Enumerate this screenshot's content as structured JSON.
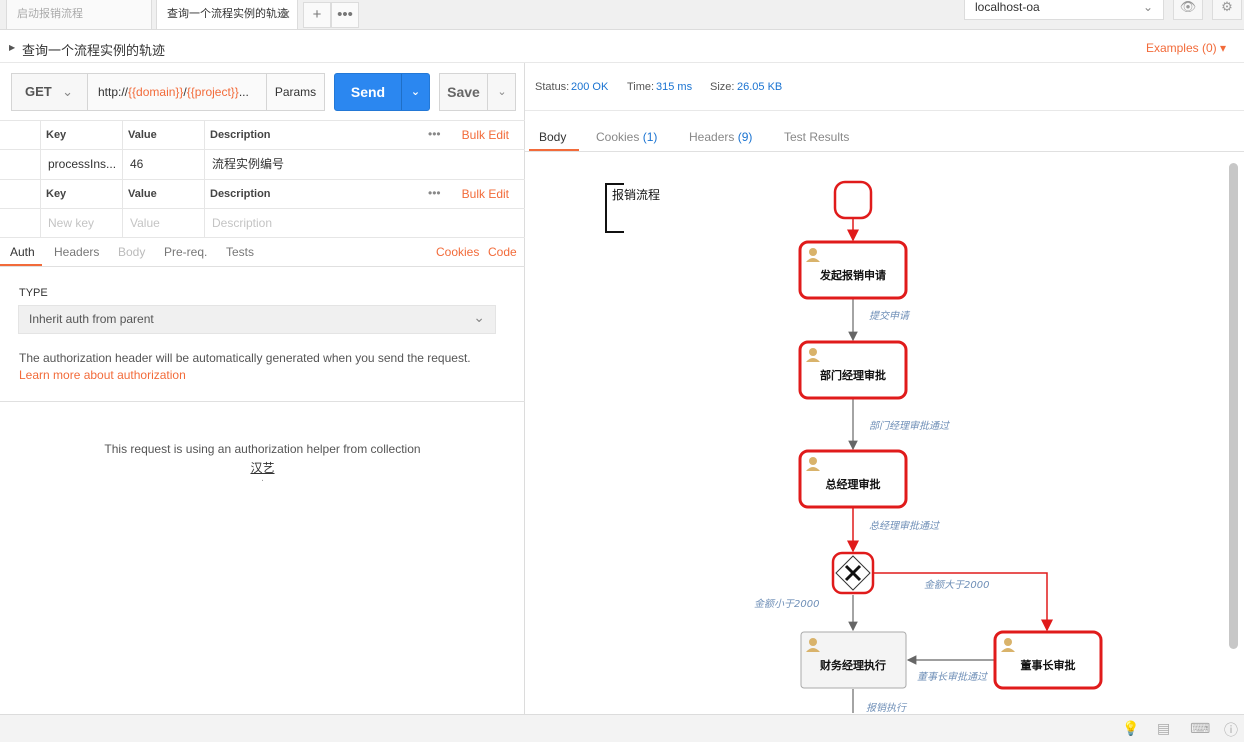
{
  "tabs": [
    {
      "label": "启动报销流程"
    },
    {
      "label": "查询一个流程实例的轨迹"
    }
  ],
  "environment": "localhost-oa",
  "request": {
    "title": "查询一个流程实例的轨迹",
    "examples": "Examples (0)",
    "method": "GET",
    "url_prefix": "http://",
    "url_var1": "{{domain}}",
    "url_sep": "/",
    "url_var2": "{{project}}",
    "url_ellipsis": "...",
    "params_label": "Params",
    "send_label": "Send",
    "save_label": "Save"
  },
  "params_table": {
    "headers": {
      "key": "Key",
      "value": "Value",
      "description": "Description"
    },
    "bulk_edit": "Bulk Edit",
    "rows": [
      {
        "key": "processIns...",
        "value": "46",
        "description": "流程实例编号"
      }
    ]
  },
  "headers_table": {
    "headers": {
      "key": "Key",
      "value": "Value",
      "description": "Description"
    },
    "bulk_edit": "Bulk Edit",
    "placeholders": {
      "key": "New key",
      "value": "Value",
      "description": "Description"
    }
  },
  "req_tabs": {
    "auth": "Auth",
    "headers": "Headers",
    "body": "Body",
    "prereq": "Pre-req.",
    "tests": "Tests",
    "cookies": "Cookies",
    "code": "Code"
  },
  "auth": {
    "type_label": "TYPE",
    "type_value": "Inherit auth from parent",
    "info": "The authorization header will be automatically generated when you send the request.",
    "learn_more": "Learn more about authorization",
    "helper_text": "This request is using an authorization helper from collection",
    "collection": "汉艺",
    "dot": "."
  },
  "response": {
    "status_label": "Status:",
    "status_value": "200 OK",
    "time_label": "Time:",
    "time_value": "315 ms",
    "size_label": "Size:",
    "size_value": "26.05 KB",
    "tabs": {
      "body": "Body",
      "cookies": "Cookies",
      "cookies_count": "(1)",
      "headers": "Headers",
      "headers_count": "(9)",
      "tests": "Test Results"
    }
  },
  "diagram": {
    "pool_label": "报销流程",
    "tasks": {
      "t1": "发起报销申请",
      "t2": "部门经理审批",
      "t3": "总经理审批",
      "t4": "财务经理执行",
      "t5": "董事长审批"
    },
    "flows": {
      "f1": "提交申请",
      "f2": "部门经理审批通过",
      "f3": "总经理审批通过",
      "f4": "金额小于2000",
      "f5": "金额大于2000",
      "f6": "董事长审批通过",
      "f7": "报销执行"
    },
    "highlight_color": "#e01b1b",
    "flow_label_color": "#6f8fb7"
  }
}
